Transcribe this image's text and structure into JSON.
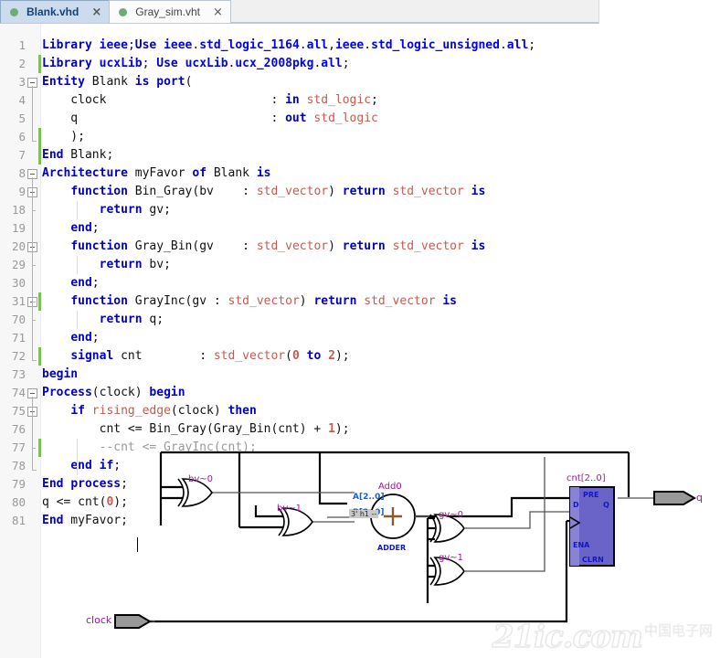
{
  "tabs": [
    {
      "label": "Blank.vhd",
      "active": true,
      "dot_color": "#6cac76",
      "close": "×"
    },
    {
      "label": "Gray_sim.vht",
      "active": false,
      "dot_color": "#6cac76",
      "close": "×"
    }
  ],
  "editor": {
    "lines": [
      {
        "num": "1",
        "fold": "none",
        "indent": 0,
        "tokens": [
          {
            "t": "Library",
            "c": "kw"
          },
          {
            "t": " ",
            "c": "pln"
          },
          {
            "t": "ieee",
            "c": "kw2"
          },
          {
            "t": ";",
            "c": "op"
          },
          {
            "t": "Use",
            "c": "kw"
          },
          {
            "t": " ",
            "c": "pln"
          },
          {
            "t": "ieee",
            "c": "kw2"
          },
          {
            "t": ".",
            "c": "op"
          },
          {
            "t": "std_logic_1164",
            "c": "kw2"
          },
          {
            "t": ".",
            "c": "op"
          },
          {
            "t": "all",
            "c": "kw2"
          },
          {
            "t": ",",
            "c": "op"
          },
          {
            "t": "ieee",
            "c": "kw2"
          },
          {
            "t": ".",
            "c": "op"
          },
          {
            "t": "std_logic_unsigned",
            "c": "kw2"
          },
          {
            "t": ".",
            "c": "op"
          },
          {
            "t": "all",
            "c": "kw2"
          },
          {
            "t": ";",
            "c": "op"
          }
        ]
      },
      {
        "num": "2",
        "fold": "none",
        "change": true,
        "indent": 0,
        "tokens": [
          {
            "t": "Library",
            "c": "kw"
          },
          {
            "t": " ",
            "c": "pln"
          },
          {
            "t": "ucxLib",
            "c": "kw2"
          },
          {
            "t": "; ",
            "c": "op"
          },
          {
            "t": "Use",
            "c": "kw"
          },
          {
            "t": " ",
            "c": "pln"
          },
          {
            "t": "ucxLib",
            "c": "kw2"
          },
          {
            "t": ".",
            "c": "op"
          },
          {
            "t": "ucx_2008pkg",
            "c": "kw2"
          },
          {
            "t": ".",
            "c": "op"
          },
          {
            "t": "all",
            "c": "kw2"
          },
          {
            "t": ";",
            "c": "op"
          }
        ]
      },
      {
        "num": "3",
        "fold": "minus",
        "indent": 0,
        "tokens": [
          {
            "t": "Entity",
            "c": "kw"
          },
          {
            "t": " Blank ",
            "c": "pln"
          },
          {
            "t": "is",
            "c": "kw"
          },
          {
            "t": " ",
            "c": "pln"
          },
          {
            "t": "port",
            "c": "kw"
          },
          {
            "t": "(",
            "c": "op"
          }
        ]
      },
      {
        "num": "4",
        "fold": "none",
        "indent": 1,
        "tokens": [
          {
            "t": "    clock                       : ",
            "c": "pln"
          },
          {
            "t": "in",
            "c": "kw"
          },
          {
            "t": " ",
            "c": "pln"
          },
          {
            "t": "std_logic",
            "c": "typ"
          },
          {
            "t": ";",
            "c": "op"
          }
        ]
      },
      {
        "num": "5",
        "fold": "none",
        "indent": 1,
        "tokens": [
          {
            "t": "    q                           : ",
            "c": "pln"
          },
          {
            "t": "out",
            "c": "kw"
          },
          {
            "t": " ",
            "c": "pln"
          },
          {
            "t": "std_logic",
            "c": "typ"
          }
        ]
      },
      {
        "num": "6",
        "fold": "none",
        "change": true,
        "indent": 1,
        "tokens": [
          {
            "t": "    );",
            "c": "pln"
          }
        ]
      },
      {
        "num": "7",
        "fold": "none",
        "change": true,
        "indent": 0,
        "tokens": [
          {
            "t": "End",
            "c": "kw"
          },
          {
            "t": " Blank",
            "c": "pln"
          },
          {
            "t": ";",
            "c": "op"
          }
        ]
      },
      {
        "num": "8",
        "fold": "minus",
        "indent": 0,
        "tokens": [
          {
            "t": "Architecture",
            "c": "kw"
          },
          {
            "t": " myFavor ",
            "c": "pln"
          },
          {
            "t": "of",
            "c": "kw"
          },
          {
            "t": " Blank ",
            "c": "pln"
          },
          {
            "t": "is",
            "c": "kw"
          }
        ]
      },
      {
        "num": "9",
        "fold": "plus",
        "indent": 1,
        "tokens": [
          {
            "t": "    ",
            "c": "pln"
          },
          {
            "t": "function",
            "c": "kw"
          },
          {
            "t": " Bin_Gray(bv    : ",
            "c": "pln"
          },
          {
            "t": "std_vector",
            "c": "typ"
          },
          {
            "t": ") ",
            "c": "pln"
          },
          {
            "t": "return",
            "c": "kw"
          },
          {
            "t": " ",
            "c": "pln"
          },
          {
            "t": "std_vector",
            "c": "typ"
          },
          {
            "t": " ",
            "c": "pln"
          },
          {
            "t": "is",
            "c": "kw"
          }
        ]
      },
      {
        "num": "18",
        "fold": "none",
        "indent": 2,
        "tokens": [
          {
            "t": "        ",
            "c": "pln"
          },
          {
            "t": "return",
            "c": "kw"
          },
          {
            "t": " gv",
            "c": "pln"
          },
          {
            "t": ";",
            "c": "op"
          }
        ]
      },
      {
        "num": "19",
        "fold": "none",
        "indent": 1,
        "tokens": [
          {
            "t": "    ",
            "c": "pln"
          },
          {
            "t": "end",
            "c": "kw"
          },
          {
            "t": ";",
            "c": "op"
          }
        ]
      },
      {
        "num": "20",
        "fold": "plus",
        "indent": 1,
        "tokens": [
          {
            "t": "    ",
            "c": "pln"
          },
          {
            "t": "function",
            "c": "kw"
          },
          {
            "t": " Gray_Bin(gv    : ",
            "c": "pln"
          },
          {
            "t": "std_vector",
            "c": "typ"
          },
          {
            "t": ") ",
            "c": "pln"
          },
          {
            "t": "return",
            "c": "kw"
          },
          {
            "t": " ",
            "c": "pln"
          },
          {
            "t": "std_vector",
            "c": "typ"
          },
          {
            "t": " ",
            "c": "pln"
          },
          {
            "t": "is",
            "c": "kw"
          }
        ]
      },
      {
        "num": "29",
        "fold": "none",
        "indent": 2,
        "tokens": [
          {
            "t": "        ",
            "c": "pln"
          },
          {
            "t": "return",
            "c": "kw"
          },
          {
            "t": " bv",
            "c": "pln"
          },
          {
            "t": ";",
            "c": "op"
          }
        ]
      },
      {
        "num": "30",
        "fold": "none",
        "indent": 1,
        "tokens": [
          {
            "t": "    ",
            "c": "pln"
          },
          {
            "t": "end",
            "c": "kw"
          },
          {
            "t": ";",
            "c": "op"
          }
        ]
      },
      {
        "num": "31",
        "fold": "plus",
        "change": true,
        "indent": 1,
        "tokens": [
          {
            "t": "    ",
            "c": "pln"
          },
          {
            "t": "function",
            "c": "kw"
          },
          {
            "t": " GrayInc(gv : ",
            "c": "pln"
          },
          {
            "t": "std_vector",
            "c": "typ"
          },
          {
            "t": ") ",
            "c": "pln"
          },
          {
            "t": "return",
            "c": "kw"
          },
          {
            "t": " ",
            "c": "pln"
          },
          {
            "t": "std_vector",
            "c": "typ"
          },
          {
            "t": " ",
            "c": "pln"
          },
          {
            "t": "is",
            "c": "kw"
          }
        ]
      },
      {
        "num": "70",
        "fold": "none",
        "indent": 2,
        "tokens": [
          {
            "t": "        ",
            "c": "pln"
          },
          {
            "t": "return",
            "c": "kw"
          },
          {
            "t": " q",
            "c": "pln"
          },
          {
            "t": ";",
            "c": "op"
          }
        ]
      },
      {
        "num": "71",
        "fold": "none",
        "indent": 1,
        "tokens": [
          {
            "t": "    ",
            "c": "pln"
          },
          {
            "t": "end",
            "c": "kw"
          },
          {
            "t": ";",
            "c": "op"
          }
        ]
      },
      {
        "num": "72",
        "fold": "none",
        "change": true,
        "indent": 1,
        "tokens": [
          {
            "t": "    ",
            "c": "pln"
          },
          {
            "t": "signal",
            "c": "kw"
          },
          {
            "t": " cnt        : ",
            "c": "pln"
          },
          {
            "t": "std_vector",
            "c": "typ"
          },
          {
            "t": "(",
            "c": "pln"
          },
          {
            "t": "0",
            "c": "num"
          },
          {
            "t": " ",
            "c": "pln"
          },
          {
            "t": "to",
            "c": "kw"
          },
          {
            "t": " ",
            "c": "pln"
          },
          {
            "t": "2",
            "c": "num"
          },
          {
            "t": ");",
            "c": "pln"
          }
        ]
      },
      {
        "num": "73",
        "fold": "none",
        "indent": 0,
        "tokens": [
          {
            "t": "begin",
            "c": "kw"
          }
        ]
      },
      {
        "num": "74",
        "fold": "minus",
        "indent": 0,
        "tokens": [
          {
            "t": "Process",
            "c": "kw"
          },
          {
            "t": "(clock) ",
            "c": "pln"
          },
          {
            "t": "begin",
            "c": "kw"
          }
        ]
      },
      {
        "num": "75",
        "fold": "minus",
        "indent": 1,
        "tokens": [
          {
            "t": "    ",
            "c": "pln"
          },
          {
            "t": "if",
            "c": "kw"
          },
          {
            "t": " ",
            "c": "pln"
          },
          {
            "t": "rising_edge",
            "c": "typ"
          },
          {
            "t": "(clock) ",
            "c": "pln"
          },
          {
            "t": "then",
            "c": "kw"
          }
        ]
      },
      {
        "num": "76",
        "fold": "none",
        "indent": 2,
        "tokens": [
          {
            "t": "        cnt <= Bin_Gray(Gray_Bin(cnt) + ",
            "c": "pln"
          },
          {
            "t": "1",
            "c": "num"
          },
          {
            "t": ");",
            "c": "pln"
          }
        ]
      },
      {
        "num": "77",
        "fold": "none",
        "change": true,
        "indent": 2,
        "tokens": [
          {
            "t": "        --cnt <= GrayInc(cnt);",
            "c": "cmt"
          }
        ]
      },
      {
        "num": "78",
        "fold": "none",
        "indent": 1,
        "tokens": [
          {
            "t": "    ",
            "c": "pln"
          },
          {
            "t": "end",
            "c": "kw"
          },
          {
            "t": " ",
            "c": "pln"
          },
          {
            "t": "if",
            "c": "kw"
          },
          {
            "t": ";",
            "c": "op"
          }
        ]
      },
      {
        "num": "79",
        "fold": "none",
        "indent": 0,
        "tokens": [
          {
            "t": "End",
            "c": "kw"
          },
          {
            "t": " ",
            "c": "pln"
          },
          {
            "t": "process",
            "c": "kw"
          },
          {
            "t": ";",
            "c": "op"
          }
        ]
      },
      {
        "num": "80",
        "fold": "none",
        "indent": 0,
        "tokens": [
          {
            "t": "q <= cnt(",
            "c": "pln"
          },
          {
            "t": "0",
            "c": "num"
          },
          {
            "t": ");",
            "c": "pln"
          }
        ]
      },
      {
        "num": "81",
        "fold": "none",
        "indent": 0,
        "tokens": [
          {
            "t": "End",
            "c": "kw"
          },
          {
            "t": " myFavor",
            "c": "pln"
          },
          {
            "t": ";",
            "c": "op"
          }
        ]
      }
    ]
  },
  "schematic": {
    "gates": [
      {
        "name": "bv~0",
        "type": "xor"
      },
      {
        "name": "bv~1",
        "type": "xor"
      },
      {
        "name": "gv~0",
        "type": "xor"
      },
      {
        "name": "gv~1",
        "type": "xor"
      }
    ],
    "adder": {
      "instance": "Add0",
      "symbol": "+",
      "type_label": "ADDER",
      "port_a": "A[2..0]",
      "port_b": "B[2..0]",
      "constant": "3' h1 --"
    },
    "register": {
      "instance": "cnt[2..0]",
      "port_d": "D",
      "port_q": "Q",
      "port_pre": "PRE",
      "port_ena": "ENA",
      "port_clrn": "CLRN",
      "fill_color": "#6a64c8"
    },
    "pins": [
      {
        "name": "clock",
        "direction": "input"
      },
      {
        "name": "q",
        "direction": "output"
      }
    ]
  },
  "watermark": {
    "brand": "21ic.com",
    "sub": "中国电子网"
  }
}
